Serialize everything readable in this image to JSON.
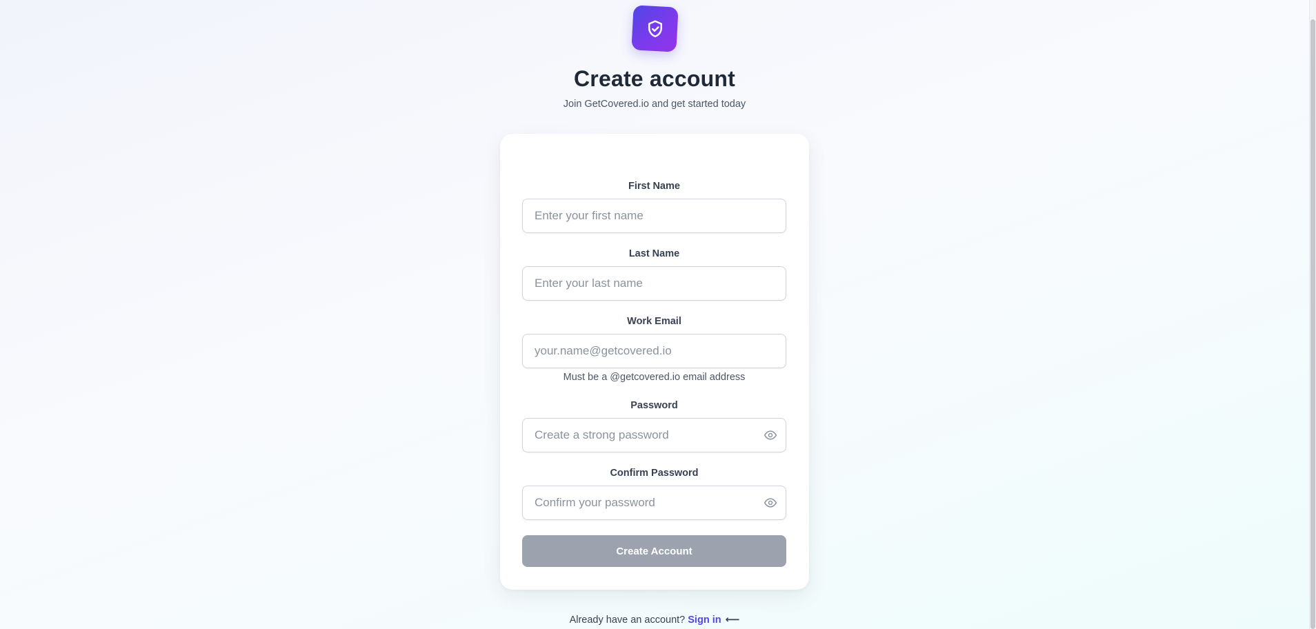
{
  "header": {
    "title": "Create account",
    "subtitle": "Join GetCovered.io and get started today"
  },
  "brand": {
    "logo_icon": "shield-check-icon",
    "gradient_start": "#4f46e5",
    "gradient_end": "#9333ea"
  },
  "form": {
    "first_name": {
      "label": "First Name",
      "placeholder": "Enter your first name",
      "value": ""
    },
    "last_name": {
      "label": "Last Name",
      "placeholder": "Enter your last name",
      "value": ""
    },
    "work_email": {
      "label": "Work Email",
      "placeholder": "your.name@getcovered.io",
      "value": "",
      "helper": "Must be a @getcovered.io email address"
    },
    "password": {
      "label": "Password",
      "placeholder": "Create a strong password",
      "value": "",
      "toggle_icon": "eye-icon"
    },
    "confirm_password": {
      "label": "Confirm Password",
      "placeholder": "Confirm your password",
      "value": "",
      "toggle_icon": "eye-icon"
    },
    "submit_label": "Create Account",
    "submit_color": "#9ca3af"
  },
  "footer": {
    "prompt": "Already have an account?",
    "link_label": "Sign in",
    "arrow": "⟵",
    "link_color": "#4f46e5"
  }
}
